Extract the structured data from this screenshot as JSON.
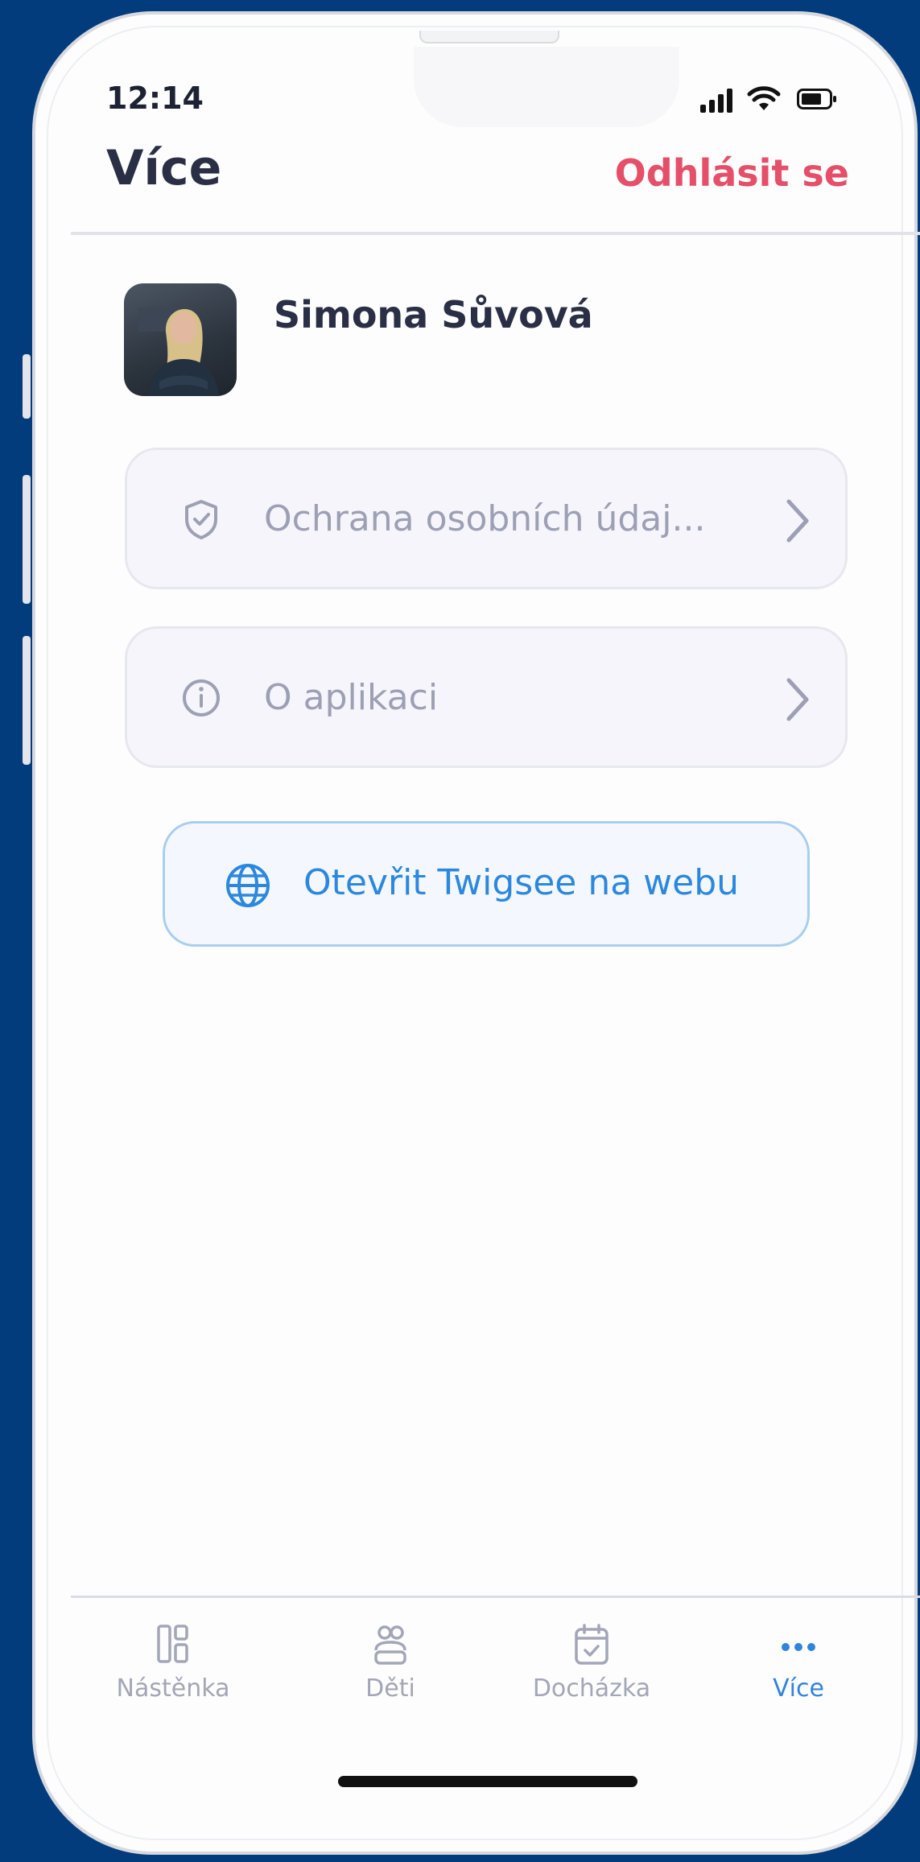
{
  "status_bar": {
    "time": "12:14"
  },
  "header": {
    "title": "Více",
    "logout_label": "Odhlásit se"
  },
  "profile": {
    "name": "Simona Sůvová"
  },
  "menu": {
    "items": [
      {
        "label": "Ochrana osobních údaj...",
        "icon": "shield-check-icon"
      },
      {
        "label": "O aplikaci",
        "icon": "info-icon"
      }
    ]
  },
  "web_button": {
    "label": "Otevřit Twigsee na webu",
    "icon": "globe-icon"
  },
  "tabbar": {
    "tabs": [
      {
        "label": "Nástěnka",
        "icon": "dashboard-icon",
        "active": false
      },
      {
        "label": "Děti",
        "icon": "children-icon",
        "active": false
      },
      {
        "label": "Docházka",
        "icon": "calendar-check-icon",
        "active": false
      },
      {
        "label": "Více",
        "icon": "more-dots-icon",
        "active": true
      }
    ]
  },
  "colors": {
    "background": "#023c7d",
    "accent_red": "#e64f69",
    "accent_blue": "#2f84dc",
    "title": "#2a2f45",
    "muted": "#9da0b5"
  }
}
